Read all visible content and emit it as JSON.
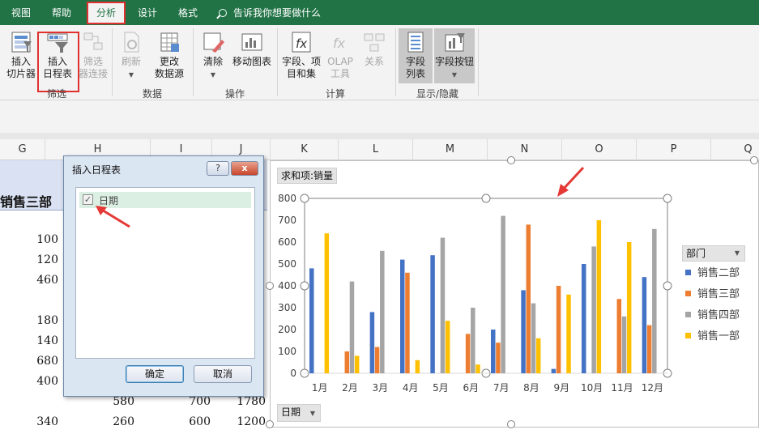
{
  "ribbon_tabs": [
    {
      "label": "视图"
    },
    {
      "label": "帮助"
    },
    {
      "label": "分析",
      "active": true
    },
    {
      "label": "设计"
    },
    {
      "label": "格式"
    }
  ],
  "tellme": "告诉我你想要做什么",
  "ribbon": {
    "filter": {
      "slicer": "插入\n切片器",
      "timeline": "插入\n日程表",
      "connections": "筛选\n器连接",
      "group": "筛选"
    },
    "data": {
      "refresh": "刷新",
      "change_source": "更改\n数据源",
      "group": "数据"
    },
    "actions": {
      "clear": "清除",
      "move_chart": "移动图表",
      "group": "操作"
    },
    "calc": {
      "fields_items": "字段、项\n目和集",
      "olap": "OLAP\n工具",
      "relations": "关系",
      "group": "计算"
    },
    "show_hide": {
      "field_list": "字段\n列表",
      "field_buttons": "字段按钮",
      "group": "显示/隐藏"
    }
  },
  "columns": [
    "G",
    "H",
    "I",
    "J",
    "K",
    "L",
    "M",
    "N",
    "O",
    "P",
    "Q"
  ],
  "sheet": {
    "header_cell": "销售三部",
    "cells_g": [
      "100",
      "120",
      "460",
      "180",
      "140",
      "680",
      "400",
      "340"
    ],
    "row_580": [
      "580",
      "700",
      "1780"
    ],
    "row_260": [
      "260",
      "600",
      "1200"
    ]
  },
  "dialog": {
    "title": "插入日程表",
    "help": "?",
    "close": "x",
    "item": "日期",
    "ok": "确定",
    "cancel": "取消"
  },
  "chart_data": {
    "type": "bar",
    "value_field_button": "求和项:销量",
    "axis_field_button": "日期",
    "legend_title": "部门",
    "categories": [
      "1月",
      "2月",
      "3月",
      "4月",
      "5月",
      "6月",
      "7月",
      "8月",
      "9月",
      "10月",
      "11月",
      "12月"
    ],
    "ylim": [
      0,
      800
    ],
    "yticks": [
      0,
      100,
      200,
      300,
      400,
      500,
      600,
      700,
      800
    ],
    "grid": false,
    "legend_position": "right",
    "series": [
      {
        "name": "销售二部",
        "color": "#4472c4",
        "values": [
          480,
          0,
          280,
          520,
          540,
          0,
          200,
          380,
          20,
          500,
          0,
          440
        ]
      },
      {
        "name": "销售三部",
        "color": "#ed7d31",
        "values": [
          0,
          100,
          120,
          460,
          0,
          180,
          140,
          680,
          400,
          0,
          340,
          220
        ]
      },
      {
        "name": "销售四部",
        "color": "#a5a5a5",
        "values": [
          0,
          420,
          560,
          0,
          620,
          300,
          720,
          320,
          0,
          580,
          260,
          660
        ]
      },
      {
        "name": "销售一部",
        "color": "#ffc000",
        "values": [
          640,
          80,
          0,
          60,
          240,
          40,
          0,
          160,
          360,
          700,
          600,
          0
        ]
      }
    ]
  }
}
